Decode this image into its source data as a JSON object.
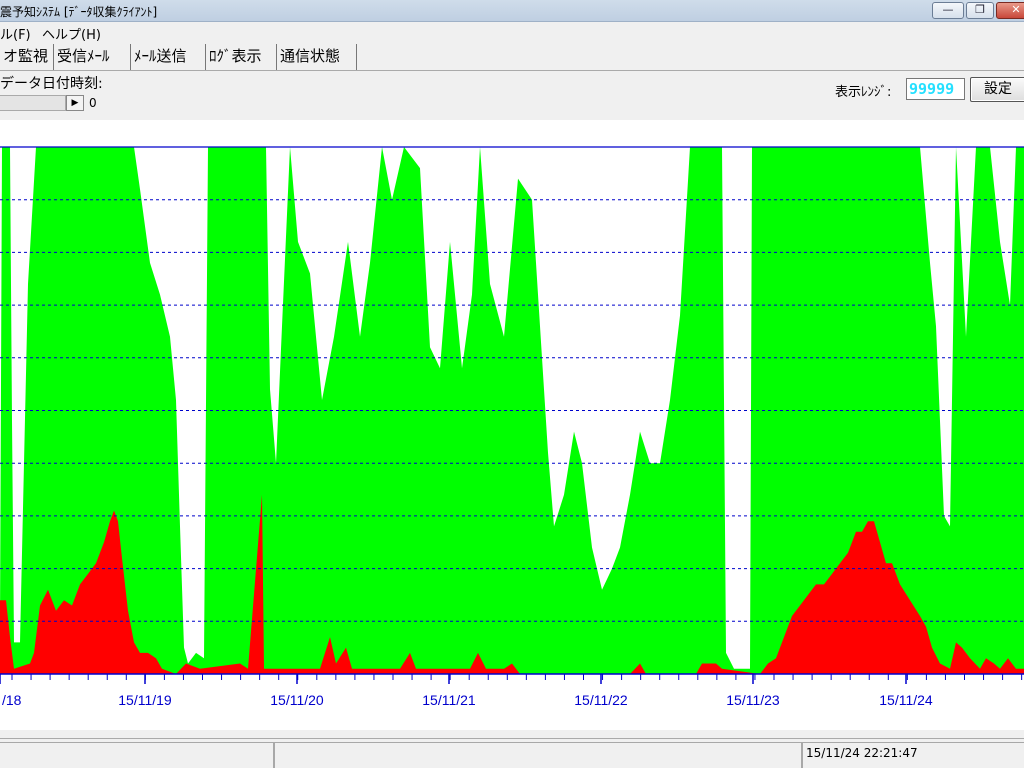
{
  "window": {
    "title": "震予知ｼｽﾃﾑ [ﾃﾞｰﾀ収集ｸﾗｲｱﾝﾄ]",
    "controls": {
      "minimize": "—",
      "maximize": "❐",
      "close": "✕"
    }
  },
  "menubar": {
    "items": [
      {
        "label": "ル(F)"
      },
      {
        "label": "ヘルプ(H)"
      }
    ]
  },
  "tabs": [
    {
      "label": "オ監視",
      "active": true
    },
    {
      "label": "受信ﾒｰﾙ"
    },
    {
      "label": "ﾒｰﾙ送信"
    },
    {
      "label": "ﾛｸﾞ表示"
    },
    {
      "label": "通信状態"
    }
  ],
  "monitor": {
    "datetime_label": "データ日付時刻:",
    "slider_value": "0",
    "range_label": "表示ﾚﾝｼﾞ:",
    "range_value": "99999",
    "set_button": "設定"
  },
  "chart_data": {
    "type": "area",
    "x_tick_labels": [
      "/18",
      "15/11/19",
      "15/11/20",
      "15/11/21",
      "15/11/22",
      "15/11/23",
      "15/11/24"
    ],
    "gridlines": "dashed horizontal, 10 levels",
    "colors": {
      "series_green": "#00ff00",
      "series_red": "#ff0000",
      "grid": "#0000cc",
      "axis": "#0000cc"
    },
    "series": [
      {
        "color": "#00ff00",
        "values": [
          [
            0,
            10
          ],
          [
            2,
            100
          ],
          [
            4,
            100
          ],
          [
            10,
            100
          ],
          [
            12,
            48
          ],
          [
            14,
            6
          ],
          [
            20,
            6
          ],
          [
            28,
            74
          ],
          [
            36,
            100
          ],
          [
            40,
            100
          ],
          [
            60,
            100
          ],
          [
            80,
            100
          ],
          [
            100,
            100
          ],
          [
            120,
            100
          ],
          [
            134,
            100
          ],
          [
            140,
            92
          ],
          [
            150,
            78
          ],
          [
            160,
            72
          ],
          [
            170,
            64
          ],
          [
            176,
            52
          ],
          [
            180,
            28
          ],
          [
            184,
            5
          ],
          [
            188,
            2
          ],
          [
            196,
            4
          ],
          [
            204,
            3
          ],
          [
            208,
            100
          ],
          [
            220,
            100
          ],
          [
            236,
            100
          ],
          [
            256,
            100
          ],
          [
            266,
            100
          ],
          [
            270,
            54
          ],
          [
            276,
            40
          ],
          [
            282,
            66
          ],
          [
            290,
            100
          ],
          [
            298,
            82
          ],
          [
            310,
            76
          ],
          [
            322,
            52
          ],
          [
            334,
            64
          ],
          [
            348,
            82
          ],
          [
            360,
            64
          ],
          [
            370,
            78
          ],
          [
            382,
            100
          ],
          [
            392,
            90
          ],
          [
            404,
            100
          ],
          [
            420,
            96
          ],
          [
            430,
            62
          ],
          [
            440,
            58
          ],
          [
            450,
            82
          ],
          [
            462,
            58
          ],
          [
            472,
            72
          ],
          [
            480,
            100
          ],
          [
            490,
            74
          ],
          [
            504,
            64
          ],
          [
            518,
            94
          ],
          [
            532,
            90
          ],
          [
            548,
            42
          ],
          [
            554,
            28
          ],
          [
            564,
            34
          ],
          [
            574,
            46
          ],
          [
            582,
            40
          ],
          [
            592,
            24
          ],
          [
            602,
            16
          ],
          [
            612,
            20
          ],
          [
            620,
            24
          ],
          [
            630,
            34
          ],
          [
            640,
            46
          ],
          [
            650,
            40
          ],
          [
            660,
            40
          ],
          [
            670,
            52
          ],
          [
            680,
            68
          ],
          [
            690,
            100
          ],
          [
            700,
            100
          ],
          [
            716,
            100
          ],
          [
            722,
            100
          ],
          [
            726,
            4
          ],
          [
            734,
            1
          ],
          [
            750,
            1
          ],
          [
            752,
            100
          ],
          [
            760,
            100
          ],
          [
            780,
            100
          ],
          [
            800,
            100
          ],
          [
            820,
            100
          ],
          [
            840,
            100
          ],
          [
            860,
            100
          ],
          [
            880,
            100
          ],
          [
            900,
            100
          ],
          [
            920,
            100
          ],
          [
            930,
            78
          ],
          [
            936,
            66
          ],
          [
            944,
            30
          ],
          [
            950,
            28
          ],
          [
            956,
            100
          ],
          [
            966,
            64
          ],
          [
            976,
            100
          ],
          [
            990,
            100
          ],
          [
            1000,
            82
          ],
          [
            1010,
            70
          ],
          [
            1016,
            100
          ],
          [
            1024,
            100
          ]
        ]
      },
      {
        "color": "#ff0000",
        "values": [
          [
            0,
            14
          ],
          [
            6,
            14
          ],
          [
            10,
            7
          ],
          [
            14,
            1
          ],
          [
            30,
            2
          ],
          [
            34,
            4
          ],
          [
            40,
            13
          ],
          [
            48,
            16
          ],
          [
            56,
            12
          ],
          [
            64,
            14
          ],
          [
            72,
            13
          ],
          [
            80,
            17
          ],
          [
            88,
            19
          ],
          [
            96,
            21
          ],
          [
            104,
            25
          ],
          [
            110,
            29
          ],
          [
            114,
            31
          ],
          [
            118,
            29
          ],
          [
            122,
            22
          ],
          [
            128,
            12
          ],
          [
            134,
            6
          ],
          [
            140,
            4
          ],
          [
            148,
            4
          ],
          [
            156,
            3
          ],
          [
            162,
            1
          ],
          [
            176,
            0
          ],
          [
            186,
            2
          ],
          [
            200,
            1
          ],
          [
            240,
            2
          ],
          [
            248,
            1
          ],
          [
            262,
            34
          ],
          [
            264,
            1
          ],
          [
            320,
            1
          ],
          [
            330,
            7
          ],
          [
            336,
            2
          ],
          [
            346,
            5
          ],
          [
            352,
            1
          ],
          [
            400,
            1
          ],
          [
            410,
            4
          ],
          [
            416,
            1
          ],
          [
            470,
            1
          ],
          [
            478,
            4
          ],
          [
            486,
            1
          ],
          [
            504,
            1
          ],
          [
            512,
            2
          ],
          [
            520,
            0
          ],
          [
            630,
            0
          ],
          [
            640,
            2
          ],
          [
            646,
            0
          ],
          [
            696,
            0
          ],
          [
            702,
            2
          ],
          [
            716,
            2
          ],
          [
            722,
            1
          ],
          [
            760,
            0
          ],
          [
            768,
            2
          ],
          [
            776,
            3
          ],
          [
            784,
            7
          ],
          [
            792,
            11
          ],
          [
            800,
            13
          ],
          [
            808,
            15
          ],
          [
            816,
            17
          ],
          [
            824,
            17
          ],
          [
            832,
            19
          ],
          [
            840,
            21
          ],
          [
            848,
            23
          ],
          [
            856,
            27
          ],
          [
            862,
            27
          ],
          [
            868,
            29
          ],
          [
            874,
            29
          ],
          [
            880,
            25
          ],
          [
            886,
            21
          ],
          [
            892,
            21
          ],
          [
            900,
            17
          ],
          [
            910,
            14
          ],
          [
            920,
            11
          ],
          [
            926,
            9
          ],
          [
            932,
            5
          ],
          [
            940,
            2
          ],
          [
            950,
            1
          ],
          [
            956,
            6
          ],
          [
            962,
            5
          ],
          [
            970,
            3
          ],
          [
            980,
            1
          ],
          [
            986,
            3
          ],
          [
            994,
            2
          ],
          [
            1000,
            1
          ],
          [
            1008,
            3
          ],
          [
            1016,
            1
          ],
          [
            1024,
            1
          ]
        ]
      }
    ],
    "ylim": [
      0,
      100
    ]
  },
  "statusbar": {
    "datetime": "15/11/24 22:21:47"
  }
}
